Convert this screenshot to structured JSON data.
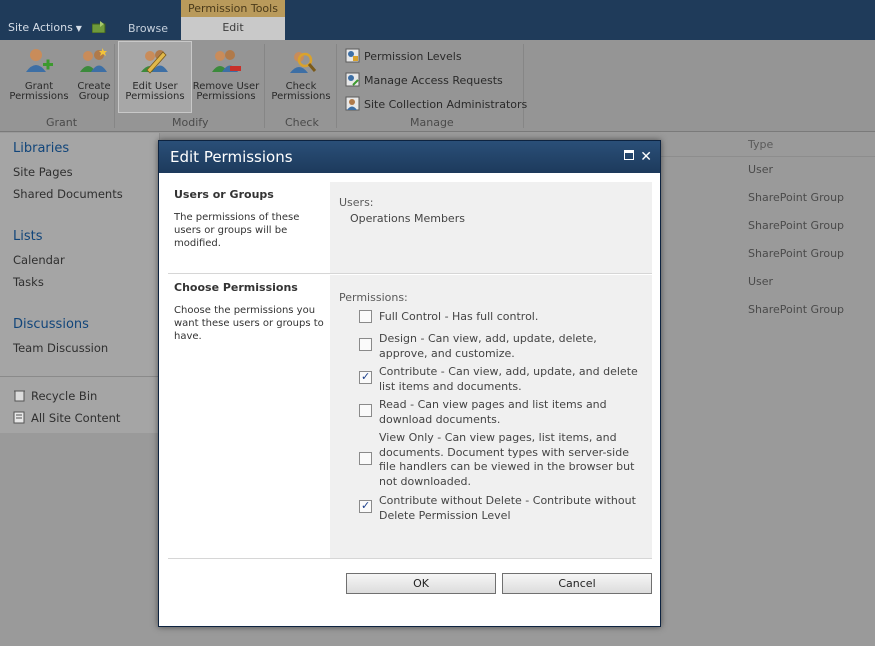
{
  "topbar": {
    "site_actions": "Site Actions",
    "tab_browse": "Browse",
    "context_group": "Permission Tools",
    "tab_edit": "Edit"
  },
  "ribbon": {
    "buttons": [
      {
        "line1": "Grant",
        "line2": "Permissions",
        "icon": "grant-permissions-icon"
      },
      {
        "line1": "Create",
        "line2": "Group",
        "icon": "create-group-icon"
      },
      {
        "line1": "Edit User",
        "line2": "Permissions",
        "icon": "edit-user-permissions-icon"
      },
      {
        "line1": "Remove User",
        "line2": "Permissions",
        "icon": "remove-user-permissions-icon"
      },
      {
        "line1": "Check",
        "line2": "Permissions",
        "icon": "check-permissions-icon"
      }
    ],
    "manage_items": [
      {
        "label": "Permission Levels",
        "icon": "permission-levels-icon"
      },
      {
        "label": "Manage Access Requests",
        "icon": "access-requests-icon"
      },
      {
        "label": "Site Collection Administrators",
        "icon": "site-admins-icon"
      }
    ],
    "group_labels": {
      "grant": "Grant",
      "modify": "Modify",
      "check": "Check",
      "manage": "Manage"
    }
  },
  "leftnav": {
    "libraries": "Libraries",
    "site_pages": "Site Pages",
    "shared_documents": "Shared Documents",
    "lists": "Lists",
    "calendar": "Calendar",
    "tasks": "Tasks",
    "discussions": "Discussions",
    "team_discussion": "Team Discussion",
    "recycle_bin": "Recycle Bin",
    "all_site_content": "All Site Content"
  },
  "type_column": {
    "header": "Type",
    "rows": [
      "User",
      "SharePoint Group",
      "SharePoint Group",
      "SharePoint Group",
      "User",
      "SharePoint Group"
    ]
  },
  "dialog": {
    "title": "Edit Permissions",
    "users_section": {
      "title": "Users or Groups",
      "description": "The permissions of these users or groups will be modified.",
      "users_label": "Users:",
      "users_value": "Operations Members"
    },
    "permissions_section": {
      "title": "Choose Permissions",
      "description": "Choose the permissions you want these users or groups to have.",
      "permissions_label": "Permissions:",
      "items": [
        {
          "label": "Full Control - Has full control.",
          "checked": false
        },
        {
          "label": "Design - Can view, add, update, delete, approve, and customize.",
          "checked": false
        },
        {
          "label": "Contribute - Can view, add, update, and delete list items and documents.",
          "checked": true
        },
        {
          "label": "Read - Can view pages and list items and download documents.",
          "checked": false
        },
        {
          "label": "View Only - Can view pages, list items, and documents. Document types with server-side file handlers can be viewed in the browser but not downloaded.",
          "checked": false
        },
        {
          "label": "Contribute without Delete - Contribute without Delete Permission Level",
          "checked": true
        }
      ]
    },
    "ok_label": "OK",
    "cancel_label": "Cancel"
  }
}
